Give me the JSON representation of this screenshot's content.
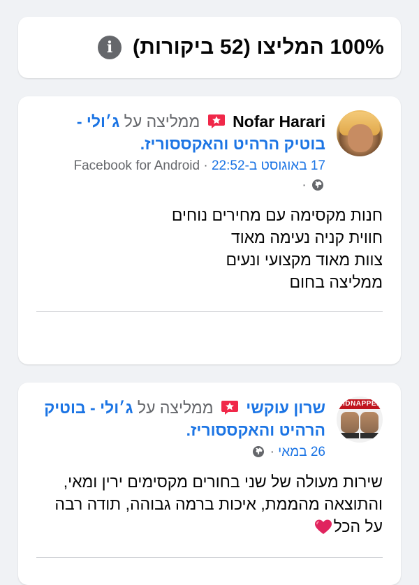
{
  "summary": {
    "title": "100% המליצו (52 ביקורות)",
    "info_icon": "info-icon"
  },
  "reviews": [
    {
      "name": "Nofar Harari",
      "recommends": "ממליצה על",
      "page_name": "ג׳ולי - בוטיק הרהיט והאקססוריז",
      "date": "17 באוגוסט ב-22:52",
      "source": "Facebook for Android",
      "sep": "·",
      "privacy_icon": "globe-icon",
      "text": "חנות מקסימה עם מחירים נוחים\nחווית קניה נעימה מאוד\nצוות מאוד מקצועי ונעים\nממליצה בחום"
    },
    {
      "name": "שרון עוקשי",
      "recommends": "ממליצה על",
      "page_name": "ג׳ולי - בוטיק הרהיט והאקססוריז",
      "date": "26 במאי",
      "sep": "·",
      "privacy_icon": "globe-icon",
      "avatar_text": "KIDNAPPED",
      "text": "שירות מעולה של שני בחורים מקסימים ירין ומאי, והתוצאה מהממת, איכות ברמה גבוהה, תודה רבה על הכל",
      "end_emoji": "heart-icon"
    }
  ],
  "colors": {
    "link": "#1b74e4",
    "muted": "#65676b",
    "recommend_badge": "#f02849",
    "background": "#f0f2f5"
  }
}
